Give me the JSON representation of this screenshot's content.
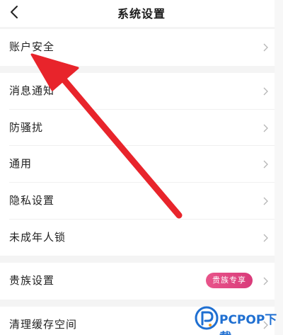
{
  "header": {
    "title": "系统设置"
  },
  "rows": [
    {
      "label": "账户安全"
    },
    {
      "label": "消息通知"
    },
    {
      "label": "防骚扰"
    },
    {
      "label": "通用"
    },
    {
      "label": "隐私设置"
    },
    {
      "label": "未成年人锁"
    },
    {
      "label": "贵族设置",
      "badge": "贵族专享"
    },
    {
      "label": "清理缓存空间"
    }
  ],
  "watermark": {
    "brand": "PCPOP下载"
  },
  "colors": {
    "arrow": "#e8242b",
    "badge": "#df4680",
    "section_gap": "#f4f4f4",
    "watermark": "#1f6fd1"
  }
}
